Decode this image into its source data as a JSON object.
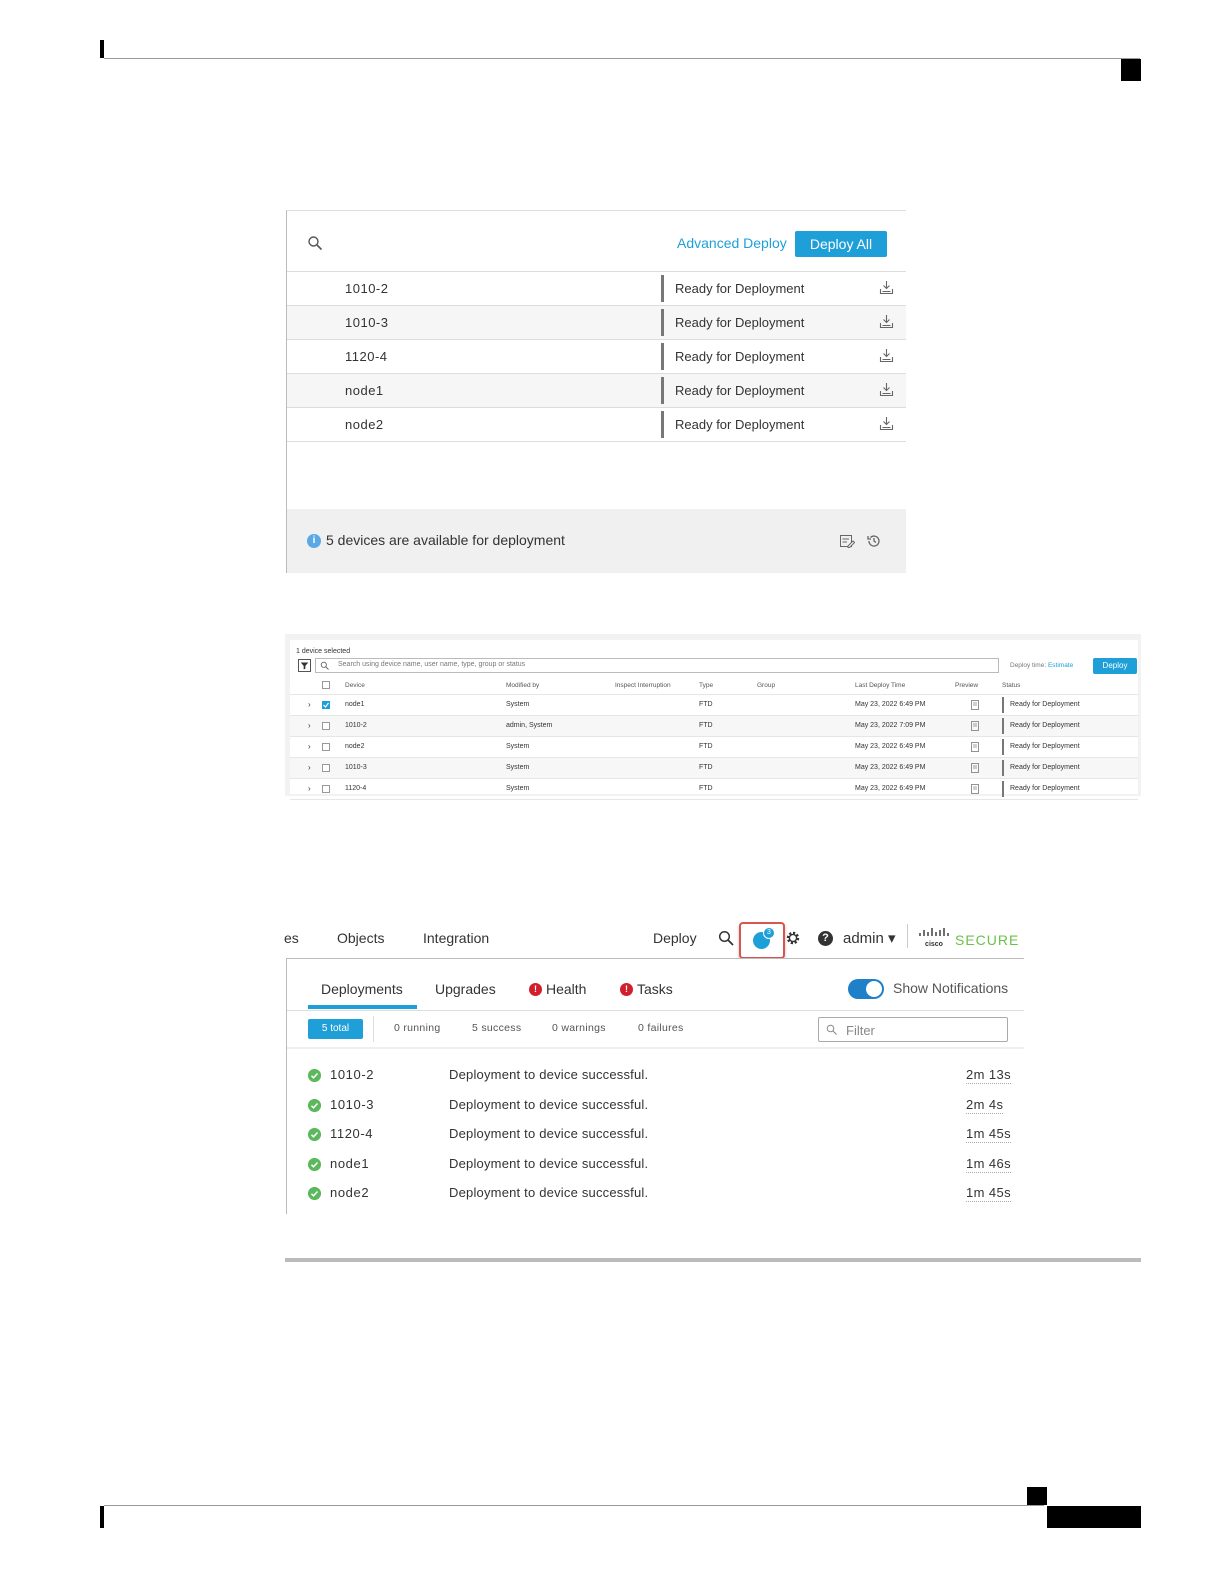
{
  "panel1": {
    "advanced_deploy": "Advanced Deploy",
    "deploy_all": "Deploy All",
    "rows": [
      {
        "name": "1010-2",
        "status": "Ready for Deployment"
      },
      {
        "name": "1010-3",
        "status": "Ready for Deployment"
      },
      {
        "name": "1120-4",
        "status": "Ready for Deployment"
      },
      {
        "name": "node1",
        "status": "Ready for Deployment"
      },
      {
        "name": "node2",
        "status": "Ready for Deployment"
      }
    ],
    "footer_text": "5 devices are available for deployment",
    "info_glyph": "i"
  },
  "panel2": {
    "selected_text": "1 device selected",
    "search_placeholder": "Search using device name, user name, type, group or status",
    "deploy_time_label": "Deploy time: ",
    "deploy_time_link": "Estimate",
    "deploy_button": "Deploy",
    "headers": {
      "device": "Device",
      "modified_by": "Modified by",
      "inspect": "Inspect Interruption",
      "type": "Type",
      "group": "Group",
      "last_deploy": "Last Deploy Time",
      "preview": "Preview",
      "status": "Status"
    },
    "rows": [
      {
        "chevron": "›",
        "device": "node1",
        "modified_by": "System",
        "type": "FTD",
        "last_deploy": "May 23, 2022 6:49 PM",
        "status": "Ready for Deployment",
        "checked": true
      },
      {
        "chevron": "›",
        "device": "1010-2",
        "modified_by": "admin, System",
        "type": "FTD",
        "last_deploy": "May 23, 2022 7:09 PM",
        "status": "Ready for Deployment",
        "checked": false
      },
      {
        "chevron": "›",
        "device": "node2",
        "modified_by": "System",
        "type": "FTD",
        "last_deploy": "May 23, 2022 6:49 PM",
        "status": "Ready for Deployment",
        "checked": false
      },
      {
        "chevron": "›",
        "device": "1010-3",
        "modified_by": "System",
        "type": "FTD",
        "last_deploy": "May 23, 2022 6:49 PM",
        "status": "Ready for Deployment",
        "checked": false
      },
      {
        "chevron": "›",
        "device": "1120-4",
        "modified_by": "System",
        "type": "FTD",
        "last_deploy": "May 23, 2022 6:49 PM",
        "status": "Ready for Deployment",
        "checked": false
      }
    ]
  },
  "panel3": {
    "nav": {
      "partial": "es",
      "objects": "Objects",
      "integration": "Integration",
      "deploy": "Deploy",
      "badge_count": "3",
      "help_glyph": "?",
      "admin": "admin ▾",
      "brand_secure": "SECURE"
    },
    "tabs": {
      "deployments": "Deployments",
      "upgrades": "Upgrades",
      "health": "Health",
      "tasks": "Tasks",
      "alert_glyph": "!"
    },
    "show_notifications": "Show Notifications",
    "counts": {
      "total": "5 total",
      "running": "0 running",
      "success": "5 success",
      "warnings": "0 warnings",
      "failures": "0 failures"
    },
    "filter_placeholder": "Filter",
    "rows": [
      {
        "name": "1010-2",
        "message": "Deployment to device successful.",
        "duration": "2m 13s"
      },
      {
        "name": "1010-3",
        "message": "Deployment to device successful.",
        "duration": "2m 4s"
      },
      {
        "name": "1120-4",
        "message": "Deployment to device successful.",
        "duration": "1m 45s"
      },
      {
        "name": "node1",
        "message": "Deployment to device successful.",
        "duration": "1m 46s"
      },
      {
        "name": "node2",
        "message": "Deployment to device successful.",
        "duration": "1m 45s"
      }
    ]
  },
  "colors": {
    "accent": "#1e9fd8",
    "success": "#5cb85c",
    "alert": "#d0202c",
    "brand_green": "#6cc04a",
    "highlight_box": "#d9534f"
  }
}
